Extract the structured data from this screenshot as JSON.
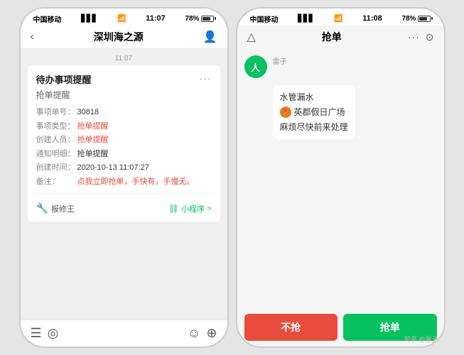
{
  "left_phone": {
    "status_bar": {
      "carrier": "中国移动",
      "wifi": "WiFi",
      "time": "11:07",
      "battery": "78%"
    },
    "nav": {
      "title": "深圳海之源",
      "back_label": "<",
      "profile_icon": "person-icon"
    },
    "timestamp": "11:07",
    "card": {
      "title": "待办事项提醒",
      "subtitle": "抢单提醒",
      "dots": "···",
      "fields": [
        {
          "label": "事项单号：",
          "value": "30818",
          "color": "normal"
        },
        {
          "label": "事项类型：",
          "value": "抢单提醒",
          "color": "red"
        },
        {
          "label": "创建人员：",
          "value": "抢单提醒",
          "color": "red"
        },
        {
          "label": "通知明细：",
          "value": "抢单提醒",
          "color": "normal"
        },
        {
          "label": "创建时间：",
          "value": "2020-10-13 11:07:27",
          "color": "normal"
        },
        {
          "label": "备注：",
          "value": "点我立即抢单，手快有，手慢无。",
          "color": "red"
        }
      ],
      "footer_left": "报修王",
      "footer_right": "小程序",
      "footer_arrow": ">"
    },
    "bottom": {
      "icon1": "☰",
      "icon2": "◎",
      "icon3": "☺",
      "icon4": "⊕"
    }
  },
  "right_phone": {
    "status_bar": {
      "carrier": "中国移动",
      "wifi": "WiFi",
      "time": "11:08",
      "battery": "78%"
    },
    "nav": {
      "home_icon": "home-icon",
      "title": "抢单",
      "dots": "···",
      "record_icon": "record-icon"
    },
    "chat": {
      "user_name": "雷子",
      "user_avatar_label": "人",
      "message1": {
        "location_icon": "location-icon",
        "line1": "水管漏水",
        "place": "英郡假日广场",
        "line2": "麻烦尽快前来处理"
      }
    },
    "buttons": {
      "reject": "不抢",
      "grab": "抢单"
    }
  },
  "watermark": "知乎 @雷子"
}
